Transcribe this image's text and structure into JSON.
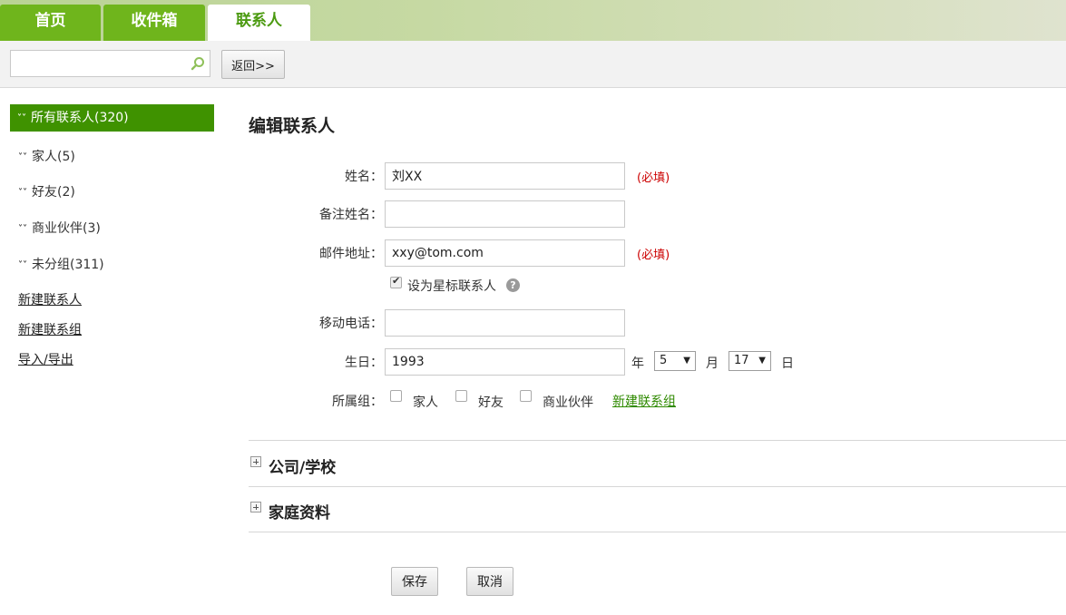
{
  "tabs": [
    {
      "label": "首页"
    },
    {
      "label": "收件箱"
    },
    {
      "label": "联系人"
    }
  ],
  "toolbar": {
    "search_value": "",
    "back_label": "返回>>"
  },
  "sidebar": {
    "all_label": "所有联系人(320)",
    "groups": [
      {
        "label": "家人(5)"
      },
      {
        "label": "好友(2)"
      },
      {
        "label": "商业伙伴(3)"
      },
      {
        "label": "未分组(311)"
      }
    ],
    "links": [
      {
        "label": "新建联系人"
      },
      {
        "label": "新建联系组"
      },
      {
        "label": "导入/导出"
      }
    ]
  },
  "form": {
    "title": "编辑联系人",
    "name_label": "姓名：",
    "name_value": "刘XX",
    "required_label": "(必填)",
    "alias_label": "备注姓名：",
    "alias_value": "",
    "email_label": "邮件地址：",
    "email_value": "xxy@tom.com",
    "star_label": "设为星标联系人",
    "star_checked": true,
    "mobile_label": "移动电话：",
    "mobile_value": "",
    "birthday_label": "生日：",
    "birth_year": "1993",
    "year_unit": "年",
    "birth_month": "5",
    "month_unit": "月",
    "birth_day": "17",
    "day_unit": "日",
    "group_label": "所属组：",
    "group_options": [
      {
        "label": "家人",
        "checked": false
      },
      {
        "label": "好友",
        "checked": false
      },
      {
        "label": "商业伙伴",
        "checked": false
      }
    ],
    "new_group_link": "新建联系组"
  },
  "sections": [
    {
      "label": "公司/学校"
    },
    {
      "label": "家庭资料"
    }
  ],
  "actions": {
    "save_label": "保存",
    "cancel_label": "取消"
  },
  "colors": {
    "accent": "#6fb51c",
    "sidebar_active": "#3f9200",
    "required": "#cc0000"
  }
}
